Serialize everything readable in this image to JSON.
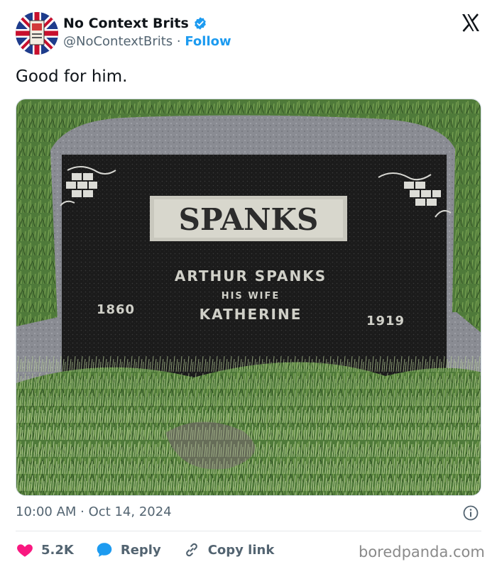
{
  "author": {
    "display_name": "No Context Brits",
    "handle": "@NoContextBrits",
    "separator": " · ",
    "follow_label": "Follow",
    "verified": true,
    "accent_color": "#1d9bf0"
  },
  "tweet": {
    "text": "Good for him."
  },
  "media": {
    "type": "photo",
    "headstone": {
      "family_name": "SPANKS",
      "line1": "ARTHUR SPANKS",
      "line2": "HIS WIFE",
      "line3": "KATHERINE",
      "year_left": "1860",
      "year_right": "1919"
    }
  },
  "meta": {
    "time": "10:00 AM",
    "date_sep": " · ",
    "date": "Oct 14, 2024"
  },
  "actions": {
    "likes": "5.2K",
    "reply_label": "Reply",
    "copy_link_label": "Copy link"
  },
  "watermark": "boredpanda.com",
  "icons": [
    "x-logo-icon",
    "verified-badge-icon",
    "info-icon",
    "heart-icon",
    "reply-icon",
    "link-icon"
  ],
  "colors": {
    "like": "#f91880",
    "reply": "#1d9bf0",
    "link": "#1d9bf0"
  }
}
